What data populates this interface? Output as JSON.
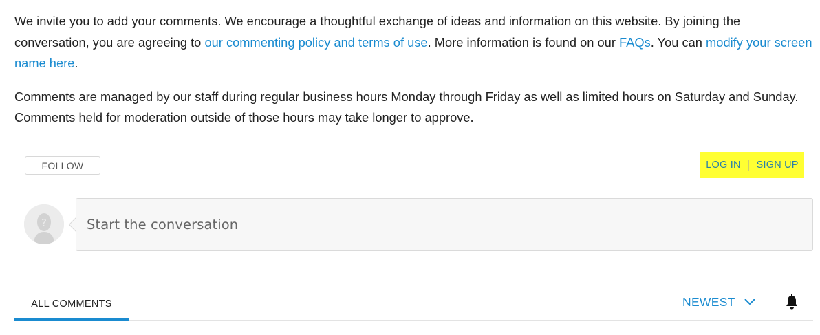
{
  "intro": {
    "p1_text_1": "We invite you to add your comments. We encourage a thoughtful exchange of ideas and information on this website. By joining the conversation, you are agreeing to ",
    "p1_link_policy": "our commenting policy and terms of use",
    "p1_text_2": ". More information is found on our ",
    "p1_link_faqs": "FAQs",
    "p1_text_3": ". You can ",
    "p1_link_screen_name": "modify your screen name here",
    "p1_text_4": ".",
    "p2_text": "Comments are managed by our staff during regular business hours Monday through Friday as well as limited hours on Saturday and Sunday. Comments held for moderation outside of those hours may take longer to approve."
  },
  "toolbar": {
    "follow_label": "FOLLOW",
    "login_label": "LOG IN",
    "signup_label": "SIGN UP"
  },
  "compose": {
    "placeholder": "Start the conversation"
  },
  "tabs": {
    "all_comments_label": "ALL COMMENTS",
    "sort_label": "NEWEST"
  },
  "icons": {
    "avatar": "default-avatar-icon",
    "sort": "chevron-down-icon",
    "notifications": "bell-icon"
  },
  "colors": {
    "link": "#1a8bd0",
    "highlight": "#ffff33",
    "text": "#222222"
  }
}
